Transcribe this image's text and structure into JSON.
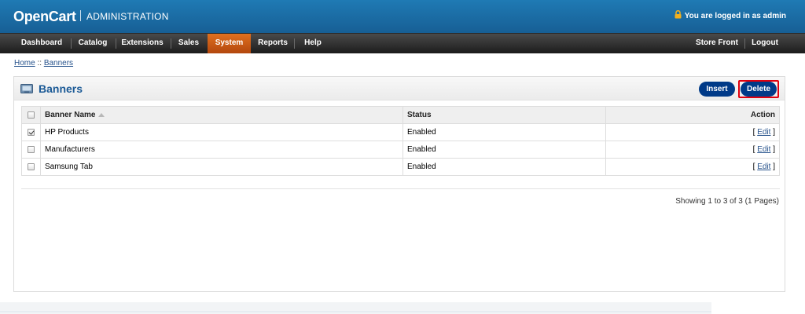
{
  "header": {
    "logo": "OpenCart",
    "subtitle": "ADMINISTRATION",
    "logged_in": "You are logged in as admin",
    "icon": "lock-icon"
  },
  "menu": {
    "left": [
      "Dashboard",
      "Catalog",
      "Extensions",
      "Sales",
      "System",
      "Reports",
      "Help"
    ],
    "active": "System",
    "right": [
      "Store Front",
      "Logout"
    ]
  },
  "breadcrumb": {
    "home": "Home",
    "separator": " :: ",
    "current": "Banners"
  },
  "box": {
    "title": "Banners",
    "insert_label": "Insert",
    "delete_label": "Delete"
  },
  "table": {
    "columns": [
      "Banner Name",
      "Status",
      "Action"
    ],
    "rows": [
      {
        "name": "HP Products",
        "status": "Enabled",
        "action_open": "[ ",
        "action": "Edit",
        "action_close": " ]",
        "checked": true
      },
      {
        "name": "Manufacturers",
        "status": "Enabled",
        "action_open": "[ ",
        "action": "Edit",
        "action_close": " ]",
        "checked": false
      },
      {
        "name": "Samsung Tab",
        "status": "Enabled",
        "action_open": "[ ",
        "action": "Edit",
        "action_close": " ]",
        "checked": false
      }
    ]
  },
  "pagination": "Showing 1 to 3 of 3 (1 Pages)",
  "colors": {
    "header": "#1f7ab4",
    "menu": "#1c1c1c",
    "active_menu": "#e0701f",
    "button": "#003a88",
    "highlight": "#e0000f"
  }
}
